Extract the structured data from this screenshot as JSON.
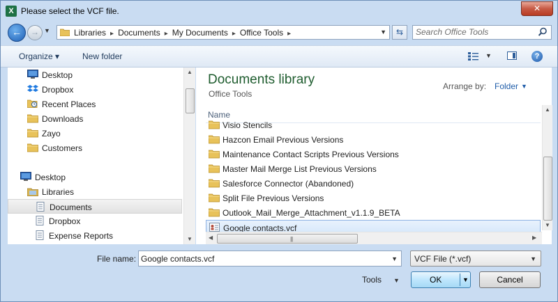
{
  "window": {
    "title": "Please select the VCF file.",
    "app_icon_letter": "X",
    "close_glyph": "✕"
  },
  "address": {
    "crumbs": [
      "Libraries",
      "Documents",
      "My Documents",
      "Office Tools"
    ],
    "separator": "▸"
  },
  "search": {
    "placeholder": "Search Office Tools"
  },
  "toolbar": {
    "organize": "Organize ▾",
    "new_folder": "New folder"
  },
  "nav": {
    "items": [
      {
        "label": "Desktop",
        "icon": "desktop-icon",
        "indent": 1
      },
      {
        "label": "Dropbox",
        "icon": "dropbox-icon",
        "indent": 1
      },
      {
        "label": "Recent Places",
        "icon": "recent-places-icon",
        "indent": 1
      },
      {
        "label": "Downloads",
        "icon": "folder-icon",
        "indent": 1
      },
      {
        "label": "Zayo",
        "icon": "folder-icon",
        "indent": 1
      },
      {
        "label": "Customers",
        "icon": "folder-icon",
        "indent": 1
      },
      {
        "label": "Desktop",
        "icon": "desktop-icon",
        "indent": 0
      },
      {
        "label": "Libraries",
        "icon": "library-icon",
        "indent": 1
      },
      {
        "label": "Documents",
        "icon": "documents-icon",
        "indent": 2,
        "selected": true
      },
      {
        "label": "Dropbox",
        "icon": "documents-icon",
        "indent": 2
      },
      {
        "label": "Expense Reports",
        "icon": "documents-icon",
        "indent": 2
      }
    ]
  },
  "content": {
    "library_title": "Documents library",
    "library_subtitle": "Office Tools",
    "arrange_label": "Arrange by:",
    "arrange_value": "Folder",
    "column_name": "Name",
    "files": [
      {
        "name": "Visio Stencils",
        "type": "folder"
      },
      {
        "name": "Hazcon Email Previous Versions",
        "type": "folder"
      },
      {
        "name": "Maintenance Contact Scripts Previous Versions",
        "type": "folder"
      },
      {
        "name": "Master Mail Merge List Previous Versions",
        "type": "folder"
      },
      {
        "name": "Salesforce Connector (Abandoned)",
        "type": "folder"
      },
      {
        "name": "Split File Previous Versions",
        "type": "folder"
      },
      {
        "name": "Outlook_Mail_Merge_Attachment_v1.1.9_BETA",
        "type": "folder"
      },
      {
        "name": "Google contacts.vcf",
        "type": "vcf",
        "selected": true
      }
    ]
  },
  "footer": {
    "file_name_label": "File name:",
    "file_name_value": "Google contacts.vcf",
    "file_type": "VCF File (*.vcf)",
    "tools_label": "Tools",
    "ok_label": "OK",
    "cancel_label": "Cancel"
  },
  "colors": {
    "accent": "#1e5ca8",
    "library_title": "#1e5c2e",
    "folder": "#e8c25a",
    "selection": "#d6e7fa"
  }
}
